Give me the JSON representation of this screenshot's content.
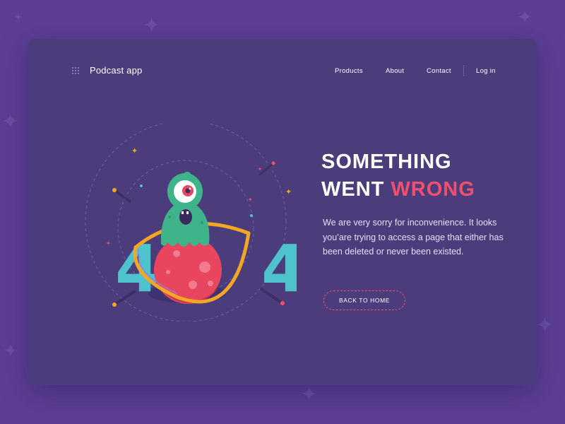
{
  "nav": {
    "brand": "Podcast app",
    "links": [
      {
        "label": "Products"
      },
      {
        "label": "About"
      },
      {
        "label": "Contact"
      }
    ],
    "login": "Log in"
  },
  "illustration": {
    "digit_left": "4",
    "digit_right": "4"
  },
  "error": {
    "headline_line1": "SOMETHING",
    "headline_line2_a": "WENT",
    "headline_line2_b": "WRONG",
    "message": "We are very sorry for inconvenience. It looks you’are trying to access a page that either has been deleted or never been existed."
  },
  "cta": {
    "label": "BACK TO HOME"
  },
  "colors": {
    "background": "#5b3f94",
    "card": "#4b3c7c",
    "accent": "#f0506e",
    "digits": "#4fc3cc",
    "planet": "#e8465f",
    "ring": "#f5a623",
    "alien": "#3fb48a"
  }
}
